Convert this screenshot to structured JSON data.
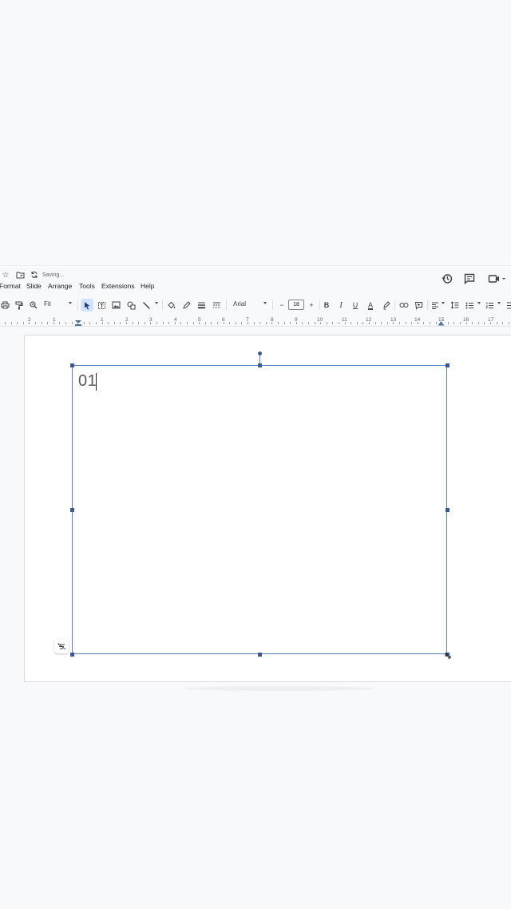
{
  "header": {
    "status": "Saving...",
    "icons": [
      "star-icon",
      "move-to-folder-icon",
      "sync-icon",
      "history-icon",
      "comment-icon",
      "meet-icon"
    ]
  },
  "menu": {
    "items": [
      {
        "id": "format",
        "label": "Format"
      },
      {
        "id": "slide",
        "label": "Slide"
      },
      {
        "id": "arrange",
        "label": "Arrange"
      },
      {
        "id": "tools",
        "label": "Tools"
      },
      {
        "id": "extensions",
        "label": "Extensions"
      },
      {
        "id": "help",
        "label": "Help"
      }
    ]
  },
  "toolbar": {
    "zoom": "Fit",
    "font_family": "Arial",
    "font_size": "18",
    "minus": "−",
    "plus": "+",
    "bold": "B",
    "italic": "I",
    "underline": "U",
    "text_color": "A",
    "accent": "#d3e3fd"
  },
  "ruler": {
    "numbers": [
      "2",
      "1",
      "1",
      "2",
      "3",
      "4",
      "5",
      "6",
      "7",
      "8",
      "9",
      "10",
      "11",
      "12",
      "13",
      "14",
      "15",
      "16",
      "17"
    ]
  },
  "slide": {
    "text": "01",
    "selection_color": "#5b7fb8"
  }
}
